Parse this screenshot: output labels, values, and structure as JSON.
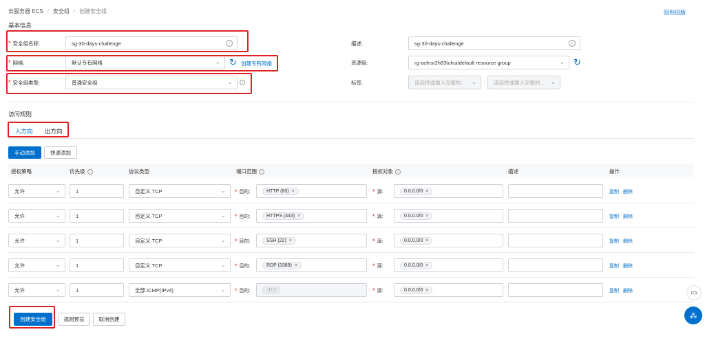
{
  "breadcrumb": [
    "云服务器 ECS",
    "安全组",
    "创建安全组"
  ],
  "back_link": "回到旧版",
  "basic_info_title": "基本信息",
  "form": {
    "name_label": "安全组名称:",
    "name_value": "sg-30-days-challenge",
    "network_label": "网络:",
    "network_value": "默认专有网络",
    "create_vpc_link": "创建专有网络",
    "type_label": "安全组类型:",
    "type_value": "普通安全组",
    "desc_label": "描述:",
    "desc_value": "sg-30-days-challenge",
    "rg_label": "资源组:",
    "rg_value": "rg-acfnsr2h63tuhui/default resource group",
    "tag_label": "标签:",
    "tag_key_placeholder": "请选择或输入完整的...",
    "tag_value_placeholder": "请选择或输入完整的..."
  },
  "rules_title": "访问规则",
  "tabs": [
    "入方向",
    "出方向"
  ],
  "actions": {
    "manual_add": "手动添加",
    "quick_add": "快速添加"
  },
  "columns": [
    "授权策略",
    "优先级",
    "协议类型",
    "端口范围",
    "授权对象",
    "描述",
    "操作"
  ],
  "rows": [
    {
      "policy": "允许",
      "priority": "1",
      "protocol": "自定义 TCP",
      "dest_label": "目的:",
      "port": "HTTP (80)",
      "src_label": "源:",
      "source": "0.0.0.0/0",
      "copy": "复制",
      "del": "删除"
    },
    {
      "policy": "允许",
      "priority": "1",
      "protocol": "自定义 TCP",
      "dest_label": "目的:",
      "port": "HTTPS (443)",
      "src_label": "源:",
      "source": "0.0.0.0/0",
      "copy": "复制",
      "del": "删除"
    },
    {
      "policy": "允许",
      "priority": "1",
      "protocol": "自定义 TCP",
      "dest_label": "目的:",
      "port": "SSH (22)",
      "src_label": "源:",
      "source": "0.0.0.0/0",
      "copy": "复制",
      "del": "删除"
    },
    {
      "policy": "允许",
      "priority": "1",
      "protocol": "自定义 TCP",
      "dest_label": "目的:",
      "port": "RDP (3389)",
      "src_label": "源:",
      "source": "0.0.0.0/0",
      "copy": "复制",
      "del": "删除"
    },
    {
      "policy": "允许",
      "priority": "1",
      "protocol": "全部 ICMP(IPv4)",
      "dest_label": "目的:",
      "port": "-1/-1",
      "src_label": "源:",
      "source": "0.0.0.0/0",
      "copy": "复制",
      "del": "删除"
    }
  ],
  "footer": {
    "create": "创建安全组",
    "preview": "规则预览",
    "cancel": "取消创建"
  },
  "colors": {
    "accent": "#0070cc",
    "highlight": "#e02020"
  }
}
